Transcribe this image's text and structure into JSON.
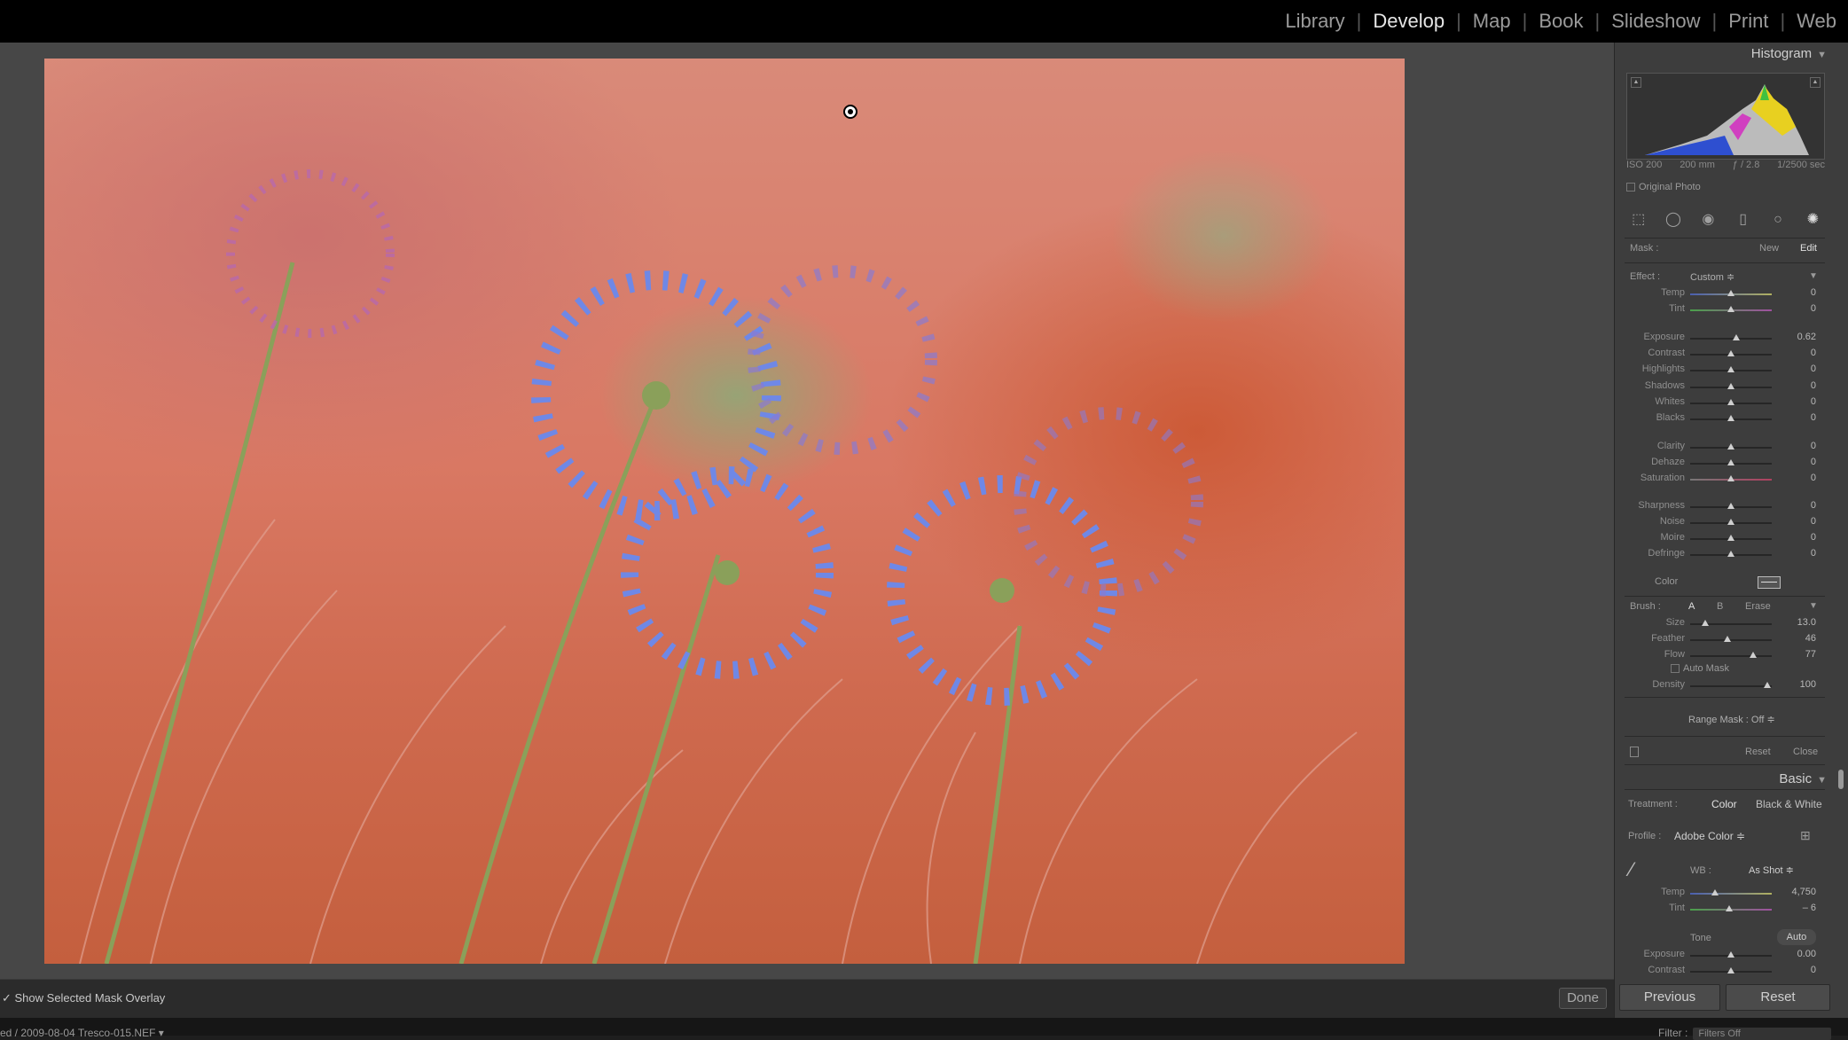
{
  "modules": [
    "Library",
    "Develop",
    "Map",
    "Book",
    "Slideshow",
    "Print",
    "Web"
  ],
  "active_module": "Develop",
  "histogram": {
    "title": "Histogram",
    "iso": "ISO 200",
    "focal": "200 mm",
    "aperture": "ƒ / 2.8",
    "shutter": "1/2500 sec",
    "original_photo": "Original Photo"
  },
  "mask_panel": {
    "mask_label": "Mask :",
    "new": "New",
    "edit": "Edit",
    "effect_label": "Effect :",
    "effect_value": "Custom ≑",
    "wb_sliders": [
      {
        "name": "Temp",
        "value": "0",
        "pos": 0.5
      },
      {
        "name": "Tint",
        "value": "0",
        "pos": 0.5
      }
    ],
    "tone_sliders": [
      {
        "name": "Exposure",
        "value": "0.62",
        "pos": 0.56
      },
      {
        "name": "Contrast",
        "value": "0",
        "pos": 0.5
      },
      {
        "name": "Highlights",
        "value": "0",
        "pos": 0.5
      },
      {
        "name": "Shadows",
        "value": "0",
        "pos": 0.5
      },
      {
        "name": "Whites",
        "value": "0",
        "pos": 0.5
      },
      {
        "name": "Blacks",
        "value": "0",
        "pos": 0.5
      }
    ],
    "presence_sliders": [
      {
        "name": "Clarity",
        "value": "0",
        "pos": 0.5
      },
      {
        "name": "Dehaze",
        "value": "0",
        "pos": 0.5
      },
      {
        "name": "Saturation",
        "value": "0",
        "pos": 0.5
      }
    ],
    "detail_sliders": [
      {
        "name": "Sharpness",
        "value": "0",
        "pos": 0.5
      },
      {
        "name": "Noise",
        "value": "0",
        "pos": 0.5
      },
      {
        "name": "Moire",
        "value": "0",
        "pos": 0.5
      },
      {
        "name": "Defringe",
        "value": "0",
        "pos": 0.5
      }
    ],
    "color_label": "Color",
    "brush_label": "Brush :",
    "brush_a": "A",
    "brush_b": "B",
    "brush_erase": "Erase",
    "brush_sliders": [
      {
        "name": "Size",
        "value": "13.0",
        "pos": 0.18
      },
      {
        "name": "Feather",
        "value": "46",
        "pos": 0.46
      },
      {
        "name": "Flow",
        "value": "77",
        "pos": 0.77
      }
    ],
    "auto_mask": "Auto Mask",
    "density": {
      "name": "Density",
      "value": "100",
      "pos": 0.95
    },
    "range_mask": "Range Mask : Off ≑",
    "reset": "Reset",
    "close": "Close"
  },
  "basic_panel": {
    "title": "Basic",
    "treatment_label": "Treatment :",
    "color": "Color",
    "bw": "Black & White",
    "profile_label": "Profile :",
    "profile_value": "Adobe Color ≑",
    "wb_label": "WB :",
    "wb_value": "As Shot ≑",
    "wb_sliders": [
      {
        "name": "Temp",
        "value": "4,750",
        "pos": 0.3
      },
      {
        "name": "Tint",
        "value": "– 6",
        "pos": 0.48
      }
    ],
    "tone_label": "Tone",
    "auto": "Auto",
    "tone_sliders": [
      {
        "name": "Exposure",
        "value": "0.00",
        "pos": 0.5
      },
      {
        "name": "Contrast",
        "value": "0",
        "pos": 0.5
      }
    ]
  },
  "bottom": {
    "show_overlay": "Show Selected Mask Overlay",
    "done": "Done",
    "previous": "Previous",
    "reset": "Reset",
    "filename": "ed / 2009-08-04 Tresco-015.NEF ▾",
    "filter_label": "Filter :",
    "filter_value": "Filters Off"
  }
}
